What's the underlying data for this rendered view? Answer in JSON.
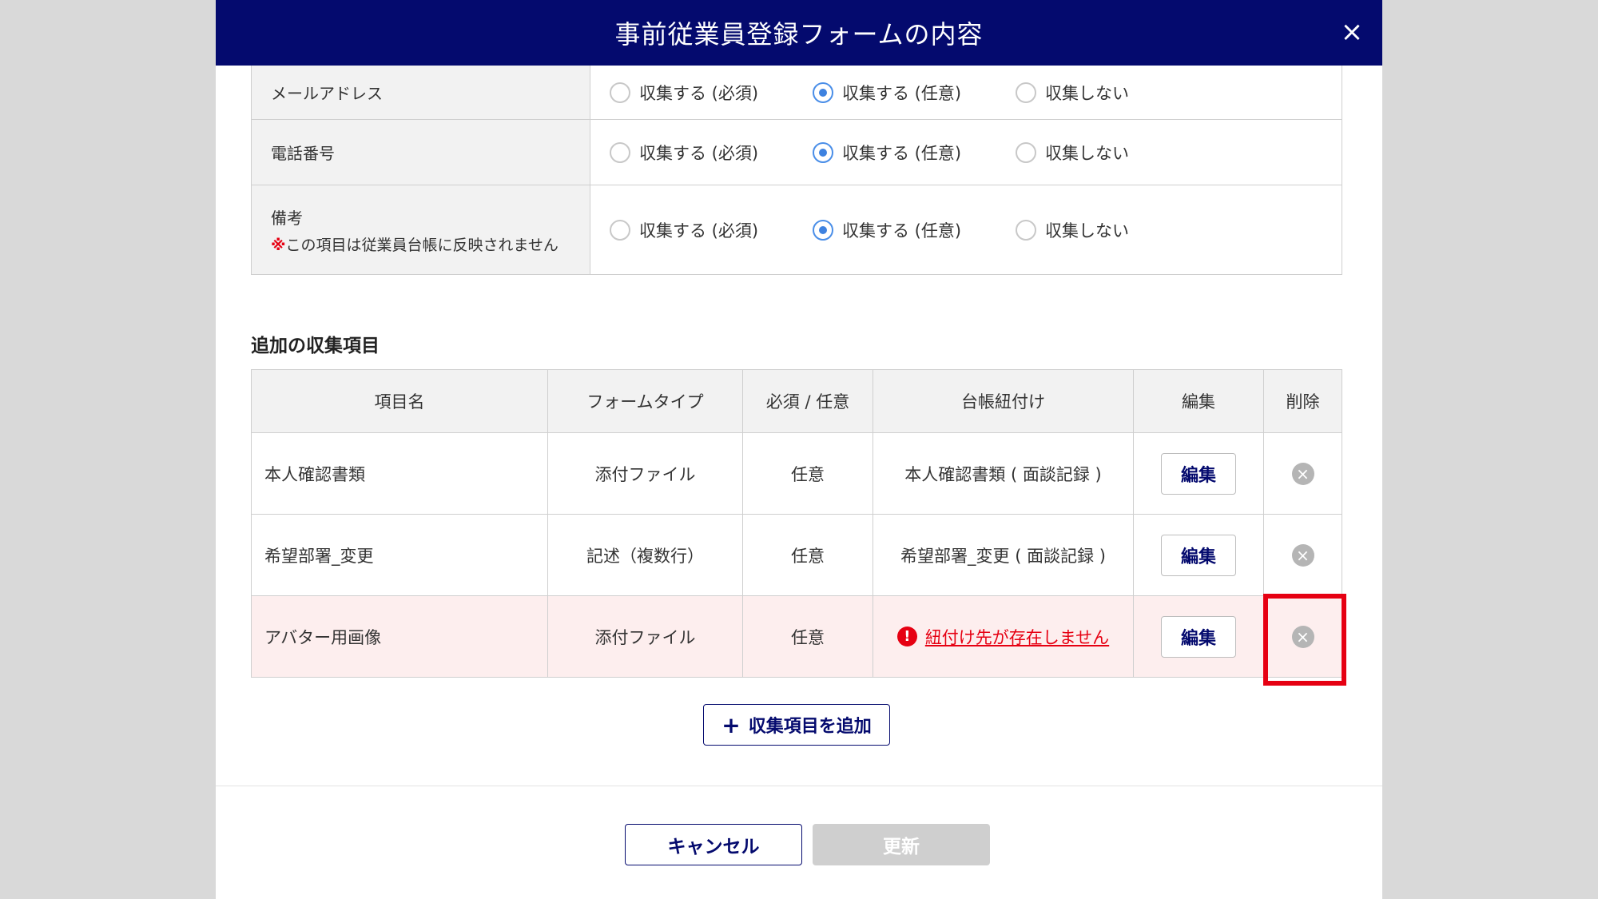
{
  "modal": {
    "title": "事前従業員登録フォームの内容",
    "close_icon": "×"
  },
  "options": {
    "required": "収集する (必須)",
    "optional": "収集する (任意)",
    "none": "収集しない"
  },
  "settings": [
    {
      "label": "メールアドレス",
      "note_mark": "",
      "note": "",
      "selected": "optional"
    },
    {
      "label": "電話番号",
      "note_mark": "",
      "note": "",
      "selected": "optional"
    },
    {
      "label": "備考",
      "note_mark": "※",
      "note": "この項目は従業員台帳に反映されません",
      "selected": "optional"
    }
  ],
  "additional": {
    "title": "追加の収集項目",
    "headers": [
      "項目名",
      "フォームタイプ",
      "必須 / 任意",
      "台帳紐付け",
      "編集",
      "削除"
    ],
    "rows": [
      {
        "name": "本人確認書類",
        "type": "添付ファイル",
        "req": "任意",
        "link": "本人確認書類 ( 面談記録 )",
        "error": false,
        "edit": "編集",
        "delete_icon": "×"
      },
      {
        "name": "希望部署_変更",
        "type": "記述（複数行）",
        "req": "任意",
        "link": "希望部署_変更 ( 面談記録 )",
        "error": false,
        "edit": "編集",
        "delete_icon": "×"
      },
      {
        "name": "アバター用画像",
        "type": "添付ファイル",
        "req": "任意",
        "link": "紐付け先が存在しません",
        "error": true,
        "error_icon": "!",
        "edit": "編集",
        "delete_icon": "×"
      }
    ],
    "add_button_icon": "+",
    "add_button": "収集項目を追加"
  },
  "footer": {
    "cancel": "キャンセル",
    "update": "更新"
  },
  "colors": {
    "header_bg": "#040a6e",
    "accent": "#3e82e0",
    "error": "#e60012",
    "error_row_bg": "#fdeeee",
    "disabled": "#cfcfcf"
  }
}
